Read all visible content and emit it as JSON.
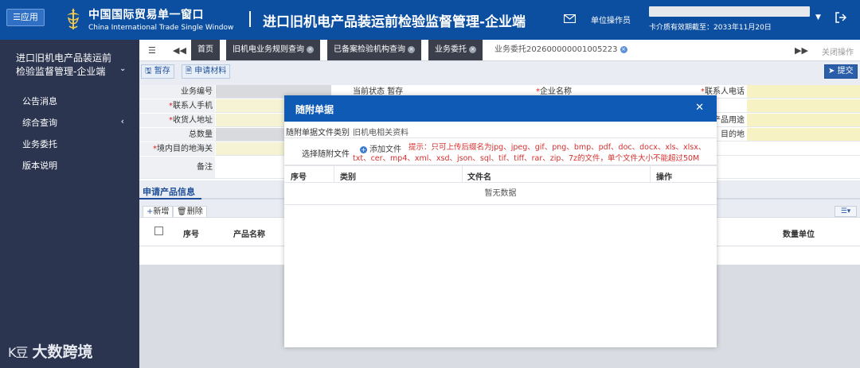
{
  "header": {
    "app_button": "☰应用",
    "brand_cn": "中国国际贸易单一窗口",
    "brand_en": "China International Trade Single Window",
    "system_title": "进口旧机电产品装运前检验监督管理-企业端",
    "operator_label": "单位操作员",
    "intro_text": "卡介质有效期截至：2033年11月20日"
  },
  "sidebar": {
    "title": "进口旧机电产品装运前检验监督管理-企业端",
    "items": [
      {
        "label": "公告消息"
      },
      {
        "label": "综合查询"
      },
      {
        "label": "业务委托"
      },
      {
        "label": "版本说明"
      }
    ]
  },
  "watermark": {
    "logo_text": "K豆",
    "text": "大数跨境"
  },
  "tabs": [
    {
      "label": "首页"
    },
    {
      "label": "旧机电业务规则查询"
    },
    {
      "label": "已备案检验机构查询"
    },
    {
      "label": "业务委托"
    },
    {
      "label": "业务委托202600000001005223"
    }
  ],
  "tabbar": {
    "close_ops": "关闭操作"
  },
  "toolbar": {
    "save": "暂存",
    "apply_materials": "申请材料",
    "submit": "提交"
  },
  "form": {
    "business_no_label": "业务编号",
    "status_label": "当前状态",
    "status_value": "暂存",
    "company_name_label": "企业名称",
    "contact_phone_label": "联系人电话",
    "contact_mobile_label": "联系人手机",
    "consignee_address_label": "收货人地址",
    "product_use_label": "产品用途",
    "total_qty_label": "总数量",
    "destination_label": "目的地",
    "domestic_port_label": "境内目的地海关",
    "remark_label": "备注"
  },
  "product_section": {
    "title": "申请产品信息",
    "add": "新增",
    "delete": "删除",
    "columns": [
      "序号",
      "产品名称",
      "数量单位"
    ]
  },
  "modal": {
    "title": "随附单据",
    "doc_type_label": "随附单据文件类别",
    "doc_type_value": "旧机电相关资料",
    "select_file_label": "选择随附文件",
    "add_file": "添加文件",
    "hint": "提示：只可上传后缀名为jpg、jpeg、gif、png、bmp、pdf、doc、docx、xls、xlsx、txt、cer、mp4、xml、xsd、json、sql、tif、tiff、rar、zip、7z的文件，单个文件大小不能超过50M",
    "columns": [
      "序号",
      "类别",
      "文件名",
      "操作"
    ],
    "empty_text": "暂无数据"
  },
  "colors": {
    "header_bg": "#0c4fa0",
    "sidebar_bg": "#2c3550",
    "modal_head": "#0f5ab5",
    "hint_red": "#d62f2f"
  }
}
